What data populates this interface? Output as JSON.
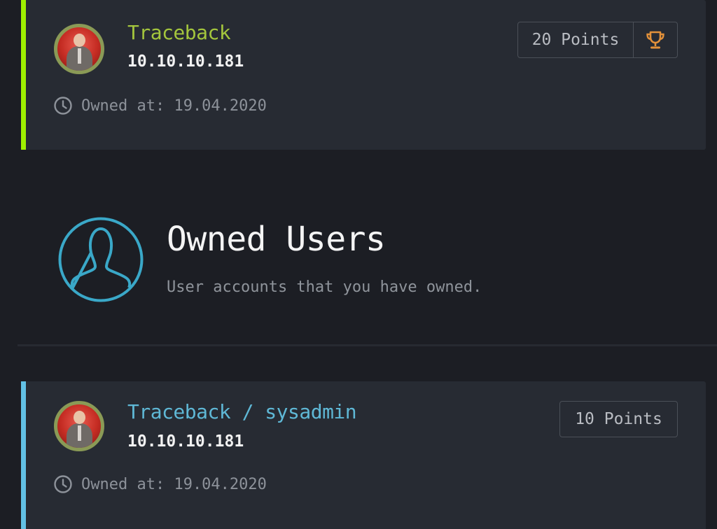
{
  "root_card": {
    "machine_name": "Traceback",
    "ip": "10.10.10.181",
    "owned_label": "Owned at: 19.04.2020",
    "points": "20 Points",
    "accent_color": "#9fef00",
    "trophy_icon": "trophy-icon"
  },
  "section": {
    "title": "Owned Users",
    "subtitle": "User accounts that you have owned.",
    "icon": "user-circle-icon"
  },
  "user_card": {
    "machine_name": "Traceback / sysadmin",
    "ip": "10.10.10.181",
    "owned_label": "Owned at: 19.04.2020",
    "points": "10 Points",
    "accent_color": "#62c1e5"
  }
}
